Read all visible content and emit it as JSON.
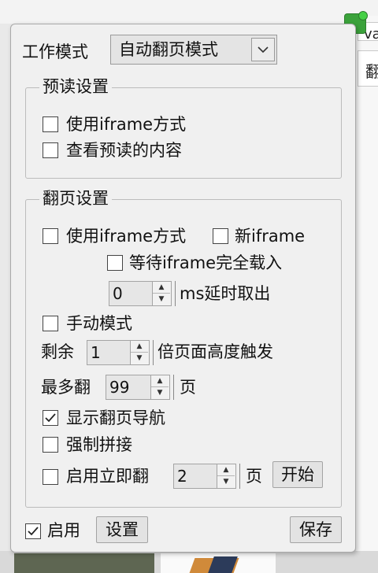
{
  "background": {
    "right_fragment_top": "va",
    "right_fragment_mid": "翻"
  },
  "panel": {
    "work_mode_label": "工作模式",
    "work_mode_value": "自动翻页模式",
    "preread": {
      "title": "预读设置",
      "use_iframe": {
        "label": "使用iframe方式",
        "checked": false
      },
      "view_content": {
        "label": "查看预读的内容",
        "checked": false
      }
    },
    "paging": {
      "title": "翻页设置",
      "use_iframe": {
        "label": "使用iframe方式",
        "checked": false
      },
      "new_iframe": {
        "label": "新iframe",
        "checked": false
      },
      "wait_iframe": {
        "label": "等待iframe完全载入",
        "checked": false
      },
      "delay_value": "0",
      "delay_suffix": "ms延时取出",
      "manual_mode": {
        "label": "手动模式",
        "checked": false
      },
      "remain_prefix": "剩余",
      "remain_value": "1",
      "remain_suffix": "倍页面高度触发",
      "max_prefix": "最多翻",
      "max_value": "99",
      "max_suffix": "页",
      "show_nav": {
        "label": "显示翻页导航",
        "checked": true
      },
      "force_join": {
        "label": "强制拼接",
        "checked": false
      },
      "instant": {
        "label": "启用立即翻",
        "checked": false
      },
      "instant_value": "2",
      "instant_suffix": "页",
      "start_label": "开始"
    },
    "enable": {
      "label": "启用",
      "checked": true
    },
    "settings_label": "设置",
    "save_label": "保存"
  }
}
